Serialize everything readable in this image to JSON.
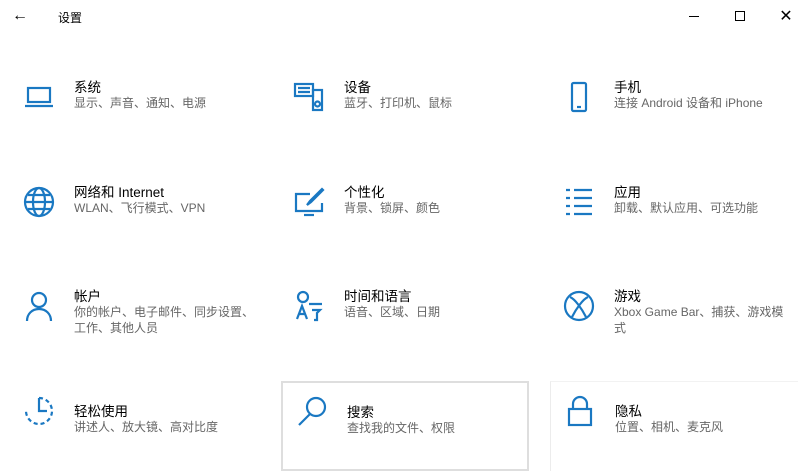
{
  "window": {
    "title": "设置",
    "back_icon": "arrow-left-icon",
    "minimize_icon": "minimize-icon",
    "maximize_icon": "maximize-icon",
    "close_icon": "close-icon"
  },
  "accent": "#1a78c2",
  "tiles": [
    {
      "title": "系统",
      "desc": "显示、声音、通知、电源",
      "icon": "laptop-icon"
    },
    {
      "title": "设备",
      "desc": "蓝牙、打印机、鼠标",
      "icon": "keyboard-speaker-icon"
    },
    {
      "title": "手机",
      "desc": "连接 Android 设备和 iPhone",
      "icon": "phone-icon"
    },
    {
      "title": "网络和 Internet",
      "desc": "WLAN、飞行模式、VPN",
      "icon": "globe-icon"
    },
    {
      "title": "个性化",
      "desc": "背景、锁屏、颜色",
      "icon": "paint-monitor-icon"
    },
    {
      "title": "应用",
      "desc": "卸载、默认应用、可选功能",
      "icon": "app-list-icon"
    },
    {
      "title": "帐户",
      "desc": "你的帐户、电子邮件、同步设置、工作、其他人员",
      "icon": "person-icon"
    },
    {
      "title": "时间和语言",
      "desc": "语音、区域、日期",
      "icon": "time-language-icon"
    },
    {
      "title": "游戏",
      "desc": "Xbox Game Bar、捕获、游戏模式",
      "icon": "xbox-icon"
    },
    {
      "title": "轻松使用",
      "desc": "讲述人、放大镜、高对比度",
      "icon": "ease-of-access-icon"
    },
    {
      "title": "搜索",
      "desc": "查找我的文件、权限",
      "icon": "search-icon"
    },
    {
      "title": "隐私",
      "desc": "位置、相机、麦克风",
      "icon": "lock-icon"
    }
  ]
}
